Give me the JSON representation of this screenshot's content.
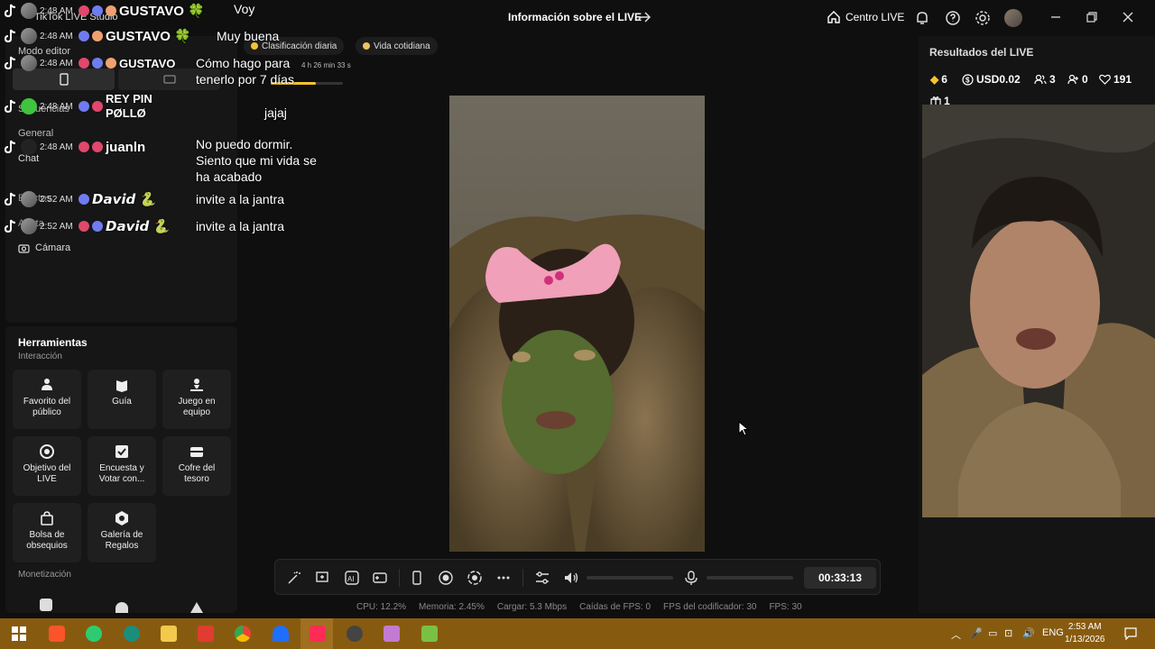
{
  "topbar": {
    "app_title": "TikTok LIVE Studio",
    "center_title": "Información sobre el LIVE",
    "centro_label": "Centro LIVE"
  },
  "left": {
    "mode_editor": "Modo editor",
    "escenas": "Secuencias",
    "general": "General",
    "chat": "Chat",
    "item_a": "Efectos",
    "item_b": "Alerta",
    "camara": "Cámara",
    "tools_title": "Herramientas",
    "section_interaccion": "Interacción",
    "section_monetizacion": "Monetización",
    "tools": [
      {
        "label": "Favorito del público",
        "icon": "people-icon"
      },
      {
        "label": "Guía",
        "icon": "book-icon"
      },
      {
        "label": "Juego en equipo",
        "icon": "team-game-icon"
      },
      {
        "label": "Objetivo del LIVE",
        "icon": "target-icon"
      },
      {
        "label": "Encuesta y Votar con...",
        "icon": "poll-icon"
      },
      {
        "label": "Cofre del tesoro",
        "icon": "chest-icon"
      },
      {
        "label": "Bolsa de obsequios",
        "icon": "gift-bag-icon"
      },
      {
        "label": "Galería de Regalos",
        "icon": "gift-gallery-icon"
      }
    ]
  },
  "tags": {
    "daily_rank": "Clasificación diaria",
    "category": "Vida cotidiana",
    "rank_timer": "4 h 26 min 33 s",
    "rank_progress_fraction": 0.62
  },
  "chat": [
    {
      "time": "2:48 AM",
      "name": "GUSTAVO 🍀",
      "msg": "Voy",
      "badge_a": "#e0486c",
      "badge_b": "#6f7cf0"
    },
    {
      "time": "2:48 AM",
      "name": "GUSTAVO 🍀",
      "msg": "Muy buena",
      "badge_a": "#6f7cf0",
      "badge_b": "#f0a070"
    },
    {
      "time": "2:48 AM",
      "name": "GUSTAVO",
      "msg": "Cómo hago para tenerlo por 7 días",
      "badge_a": "#e0486c",
      "badge_b": "#6f7cf0"
    },
    {
      "time": "2:48 AM",
      "name": "REY PIN PØLLØ",
      "msg": "jajaj",
      "badge_a": "#6f7cf0",
      "badge_b": "#e0486c"
    },
    {
      "time": "2:48 AM",
      "name": "juanln",
      "msg": "No puedo dormir. Siento que mi vida se ha acabado",
      "badge_a": "#e0486c",
      "badge_b": "#e0486c"
    },
    {
      "time": "2:52 AM",
      "name": "𝘿𝙖𝙫𝙞𝙙 🐍",
      "msg": "invite a la jantra",
      "badge_a": "#6f7cf0",
      "badge_b": "#6f7cf0"
    },
    {
      "time": "2:52 AM",
      "name": "𝘿𝙖𝙫𝙞𝙙 🐍",
      "msg": "invite a la jantra",
      "badge_a": "#e0486c",
      "badge_b": "#6f7cf0"
    }
  ],
  "controls": {
    "timer": "00:33:13",
    "volume_fraction": 0.0,
    "mic_fraction": 0.0
  },
  "stats": {
    "cpu": "CPU: 12.2%",
    "memory": "Memoria: 2.45%",
    "upload": "Cargar: 5.3 Mbps",
    "fps_drops": "Caídas de FPS: 0",
    "encoder_fps": "FPS del codificador: 30",
    "fps": "FPS: 30"
  },
  "right": {
    "title": "Resultados del LIVE",
    "diamonds": "6",
    "usd": "USD0.02",
    "viewers": "3",
    "new_followers": "0",
    "likes": "191",
    "gifters": "1"
  },
  "taskbar": {
    "lang": "ENG",
    "time": "2:53 AM",
    "date": "1/13/2026"
  },
  "colors": {
    "accent": "#fe2c55",
    "taskbar": "#875b0f",
    "gold": "#f4c430"
  }
}
